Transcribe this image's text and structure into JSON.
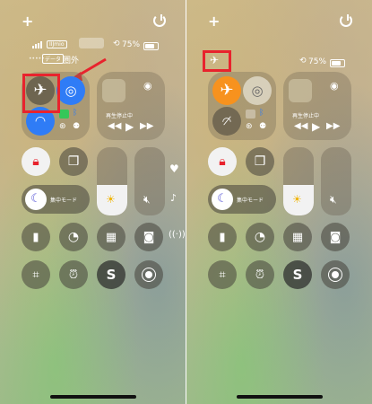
{
  "left": {
    "carrier_tag": "IIJmio",
    "data_label": "データ",
    "status_text": "圏外",
    "battery_percent": "75%",
    "now_playing": "再生停止中",
    "focus_label": "集中モード",
    "airplane_mode": "off"
  },
  "right": {
    "battery_percent": "75%",
    "now_playing": "再生停止中",
    "focus_label": "集中モード",
    "airplane_mode": "on"
  },
  "brightness_level": 0.45,
  "colors": {
    "airplane_on": "#f7921e",
    "bluetooth_blue": "#2f7cf6",
    "cellular_green": "#34c759",
    "highlight_red": "#e8232d"
  },
  "icons": {
    "add": "plus-icon",
    "power": "power-icon",
    "airplane": "airplane-icon",
    "airdrop": "airdrop-icon",
    "wifi": "wifi-icon",
    "cellular": "cellular-icon",
    "bluetooth": "bluetooth-icon",
    "hotspot": "hotspot-icon",
    "vpn": "vpn-icon",
    "airplay": "airplay-icon",
    "lock": "orientation-lock-icon",
    "mirror": "screen-mirror-icon",
    "focus": "moon-icon",
    "brightness": "sun-icon",
    "mute": "mute-icon",
    "heart": "heart-icon",
    "music": "music-note-icon",
    "antenna": "antenna-icon",
    "flashlight": "flashlight-icon",
    "timer": "timer-icon",
    "calculator": "calculator-icon",
    "camera": "camera-icon",
    "qr": "qr-scan-icon",
    "alarm": "alarm-icon",
    "shazam": "shazam-icon",
    "record": "screen-record-icon"
  }
}
